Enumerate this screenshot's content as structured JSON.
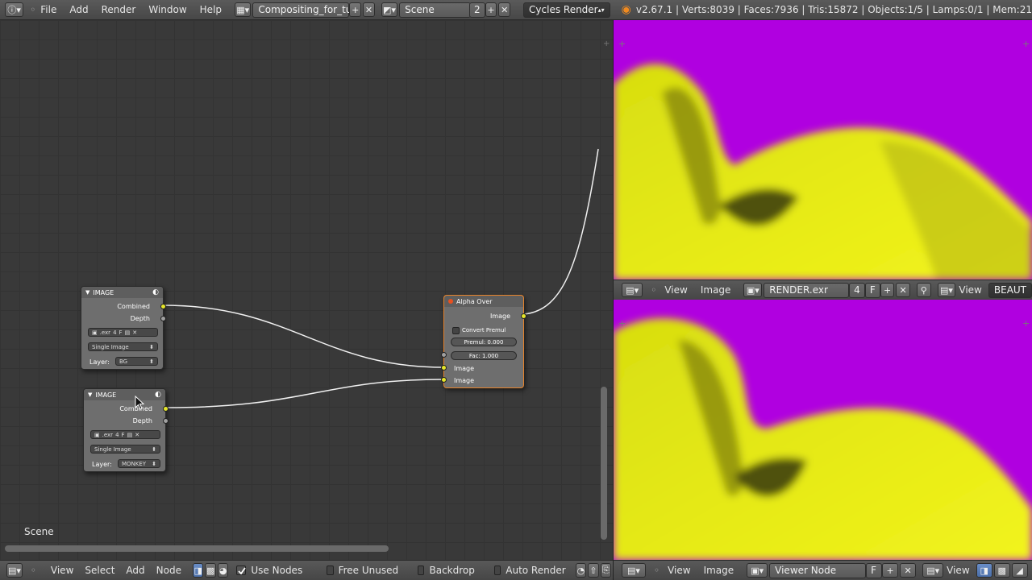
{
  "topbar": {
    "menus": [
      "File",
      "Add",
      "Render",
      "Window",
      "Help"
    ],
    "screen_layout": "Compositing_for_tut",
    "scene": "Scene",
    "scene_users": "2",
    "render_engine": "Cycles Render",
    "stats": "v2.67.1 | Verts:8039 | Faces:7936 | Tris:15872 | Objects:1/5 | Lamps:0/1 | Mem:21"
  },
  "node_editor": {
    "scene_label": "Scene",
    "nodes": {
      "image1": {
        "title": "IMAGE",
        "out_combined": "Combined",
        "out_depth": "Depth",
        "file_ext": ".exr",
        "file_users": "4",
        "file_fake": "F",
        "source": "Single Image",
        "layer_label": "Layer:",
        "layer": "BG"
      },
      "image2": {
        "title": "IMAGE",
        "out_combined": "Combined",
        "out_depth": "Depth",
        "file_ext": ".exr",
        "file_users": "4",
        "file_fake": "F",
        "source": "Single Image",
        "layer_label": "Layer:",
        "layer": "MONKEY"
      },
      "alpha_over": {
        "title": "Alpha Over",
        "out_image": "Image",
        "convert_premul": "Convert Premul",
        "premul": "Premul: 0.000",
        "fac": "Fac: 1.000",
        "in_image1": "Image",
        "in_image2": "Image"
      }
    },
    "header": {
      "menus": [
        "View",
        "Select",
        "Add",
        "Node"
      ],
      "use_nodes": "Use Nodes",
      "free_unused": "Free Unused",
      "backdrop": "Backdrop",
      "auto_render": "Auto Render"
    }
  },
  "image_editor_top": {
    "menus": [
      "View",
      "Image"
    ],
    "image_name": "RENDER.exr",
    "users": "4",
    "fake": "F",
    "view_label": "View",
    "view_mode": "BEAUT"
  },
  "image_editor_bottom": {
    "menus": [
      "View",
      "Image"
    ],
    "image_name": "Viewer Node",
    "fake": "F",
    "view_label": "View"
  },
  "colors": {
    "render_background": "#b000e0",
    "render_subject": "#e8ee10",
    "socket_yellow": "#e6e62a",
    "active_node_border": "#e8832a"
  },
  "icons": [
    "info-icon",
    "screen-layout-icon",
    "scene-icon",
    "blender-logo-icon",
    "node-editor-icon",
    "image-editor-icon",
    "pin-icon",
    "browse-image-icon",
    "add-icon",
    "close-icon"
  ]
}
